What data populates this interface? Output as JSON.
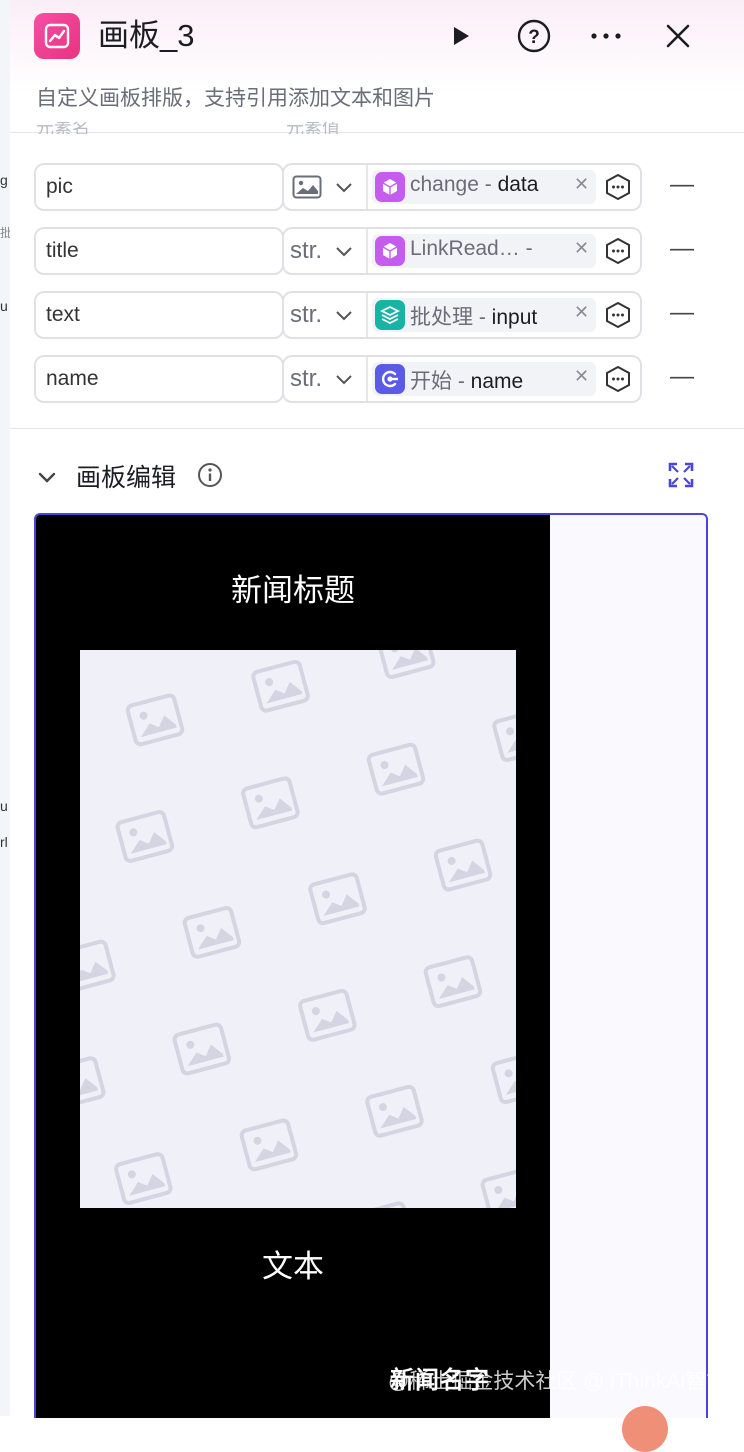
{
  "header": {
    "title": "画板_3",
    "description": "自定义画板排版，支持引用添加文本和图片"
  },
  "columns": {
    "name_hint": "元素名",
    "value_hint": "元素值"
  },
  "rows": [
    {
      "name": "pic",
      "type": "image",
      "type_label": "",
      "ref_source": "change",
      "ref_field": "data",
      "icon_color": "#c55ced"
    },
    {
      "name": "title",
      "type": "str",
      "type_label": "str.",
      "ref_source": "LinkRead…",
      "ref_field": "",
      "icon_color": "#c55ced"
    },
    {
      "name": "text",
      "type": "str",
      "type_label": "str.",
      "ref_source": "批处理",
      "ref_field": "input",
      "icon_color": "#17b3a3"
    },
    {
      "name": "name",
      "type": "str",
      "type_label": "str.",
      "ref_source": "开始",
      "ref_field": "name",
      "icon_color": "#5a5ce8"
    }
  ],
  "section": {
    "title": "画板编辑"
  },
  "board": {
    "title": "新闻标题",
    "text": "文本",
    "name": "新闻名字"
  },
  "watermark": "@稀土掘金技术社区 @ iThinkAi智能体",
  "colors": {
    "accent": "#4b47d6",
    "node_icon": "#e8337f"
  }
}
